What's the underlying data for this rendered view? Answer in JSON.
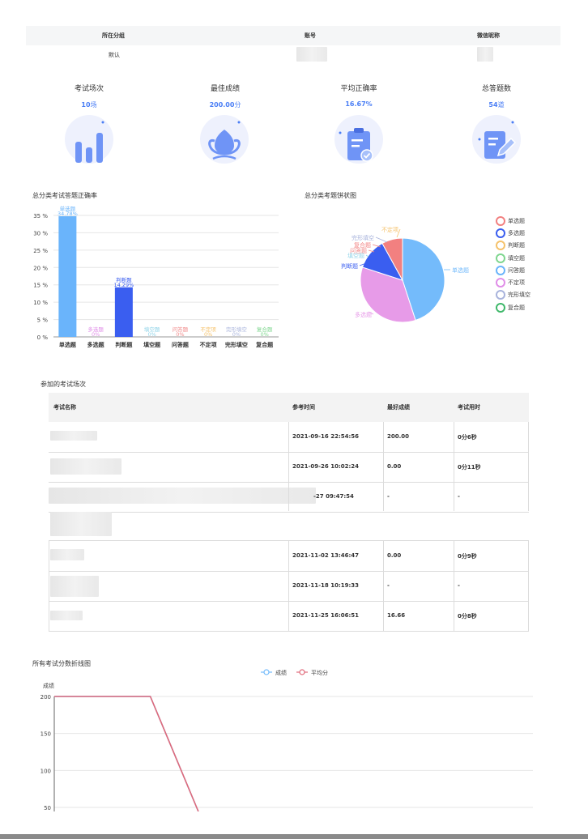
{
  "user_table": {
    "headers": [
      "所在分组",
      "账号",
      "微信昵称"
    ],
    "row": {
      "group": "默认"
    }
  },
  "stats": [
    {
      "label": "考试场次",
      "value": "10",
      "unit": "场",
      "icon": "bar-chart-icon"
    },
    {
      "label": "最佳成绩",
      "value": "200.00",
      "unit": "分",
      "icon": "flower-icon"
    },
    {
      "label": "平均正确率",
      "value": "16.67%",
      "unit": "",
      "icon": "clipboard-check-icon"
    },
    {
      "label": "总答题数",
      "value": "54",
      "unit": "道",
      "icon": "edit-note-icon"
    }
  ],
  "accent_color": "#4a7ef5",
  "bar_section_title": "总分类考试答题正确率",
  "pie_section_title": "总分类考题饼状图",
  "exams_title": "参加的考试场次",
  "line_section_title": "所有考试分数折线图",
  "exam_table": {
    "headers": [
      "考试名称",
      "参考时间",
      "最好成绩",
      "考试用时"
    ],
    "rows": [
      {
        "time": "2021-09-16 22:54:56",
        "score": "200.00",
        "duration": "0分6秒"
      },
      {
        "time": "2021-09-26 10:02:24",
        "score": "0.00",
        "duration": "0分11秒"
      },
      {
        "time": "-27 09:47:54",
        "score": "-",
        "duration": "-"
      },
      {
        "time": "",
        "score": "",
        "duration": ""
      },
      {
        "time": "2021-11-02 13:46:47",
        "score": "0.00",
        "duration": "0分9秒"
      },
      {
        "time": "2021-11-18 10:19:33",
        "score": "-",
        "duration": "-"
      },
      {
        "time": "2021-11-25 16:06:51",
        "score": "16.66",
        "duration": "0分8秒"
      }
    ]
  },
  "chart_data": [
    {
      "type": "bar",
      "categories": [
        "单选题",
        "多选题",
        "判断题",
        "填空题",
        "问答题",
        "不定项",
        "完形填空",
        "复合题"
      ],
      "values": [
        34.78,
        0,
        14.29,
        0,
        0,
        0,
        0,
        0
      ],
      "value_labels": [
        "34.78%",
        "0%",
        "14.29%",
        "0%",
        "0%",
        "0%",
        "0%",
        "0%"
      ],
      "colors": [
        "#6ab4fb",
        "#e08ee8",
        "#3a5ef0",
        "#8fd3e8",
        "#f08a8a",
        "#f5c26b",
        "#a9b4dc",
        "#7fd68f"
      ],
      "yticks": [
        "0 %",
        "5 %",
        "10 %",
        "15 %",
        "20 %",
        "25 %",
        "30 %",
        "35 %"
      ],
      "ylim": [
        0,
        35
      ],
      "grid": true
    },
    {
      "type": "pie",
      "labels": [
        "单选题",
        "多选题",
        "判断题",
        "填空题",
        "问答题",
        "不定项",
        "完形填空",
        "复合题"
      ],
      "values": [
        45,
        35,
        12,
        0,
        0,
        0,
        0,
        8
      ],
      "slice_colors": [
        "#74bbfb",
        "#e79be8",
        "#3a5ef0",
        "#8fd3e8",
        "#f08a8a",
        "#f5c26b",
        "#a9b4dc",
        "#f28080"
      ],
      "legend_colors": [
        "#f28080",
        "#3a5ef0",
        "#f5c26b",
        "#7fd68f",
        "#6ab4fb",
        "#e08ee8",
        "#a9b4dc",
        "#3fb86a"
      ],
      "legend": "right"
    },
    {
      "type": "line",
      "ylabel": "成绩",
      "series": [
        {
          "name": "成绩",
          "color": "#74bbfb",
          "values": [
            200,
            200,
            200,
            0
          ]
        },
        {
          "name": "平均分",
          "color": "#e06a7a",
          "values": [
            200,
            200,
            200,
            0
          ]
        }
      ],
      "yticks": [
        50,
        100,
        150,
        200
      ],
      "ylim": [
        50,
        200
      ],
      "grid": true,
      "legend": "top-center"
    }
  ]
}
